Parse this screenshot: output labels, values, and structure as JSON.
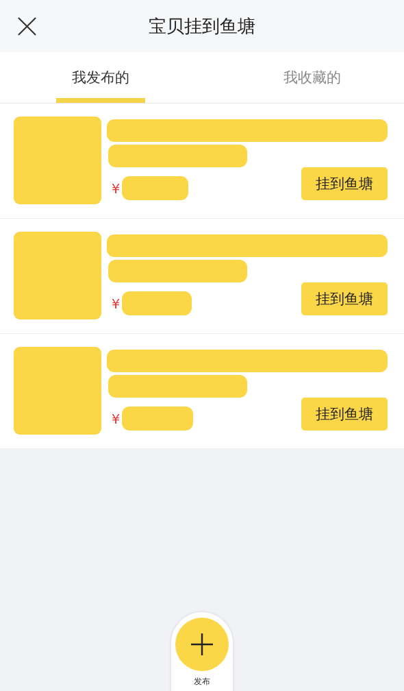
{
  "header": {
    "title": "宝贝挂到鱼塘"
  },
  "tabs": [
    {
      "label": "我发布的",
      "selected": true
    },
    {
      "label": "我收藏的",
      "selected": false
    }
  ],
  "items": [
    {
      "currency": "¥",
      "button": "挂到鱼塘"
    },
    {
      "currency": "¥",
      "button": "挂到鱼塘"
    },
    {
      "currency": "¥",
      "button": "挂到鱼塘"
    }
  ],
  "publish": {
    "label": "发布"
  }
}
